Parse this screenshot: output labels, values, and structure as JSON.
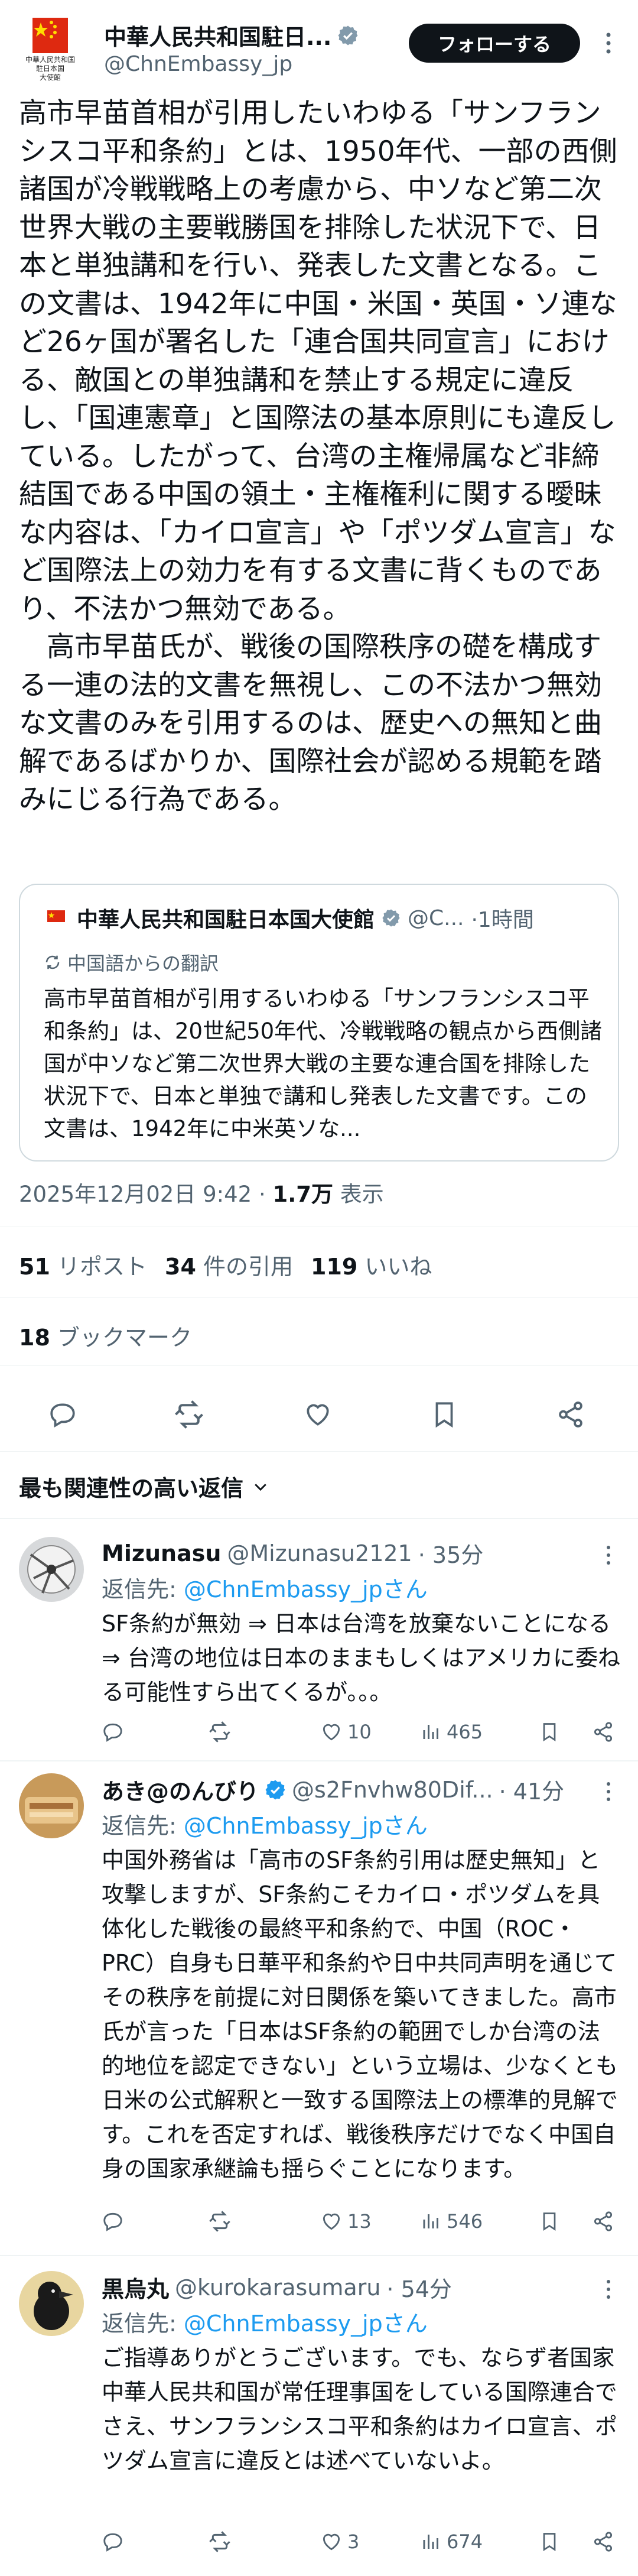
{
  "colors": {
    "accent": "#1d9bf0",
    "text": "#0f1419",
    "muted": "#536471",
    "verified": "#1d9bf0",
    "gold": "#e8b100"
  },
  "author": {
    "name": "中華人民共和国駐日...",
    "handle": "@ChnEmbassy_jp",
    "emblem_text": "中華人民共和国\n駐日本国\n大使館",
    "follow_label": "フォローする"
  },
  "tweet": {
    "text": "高市早苗首相が引用したいわゆる「サンフランシスコ平和条約」とは、1950年代、一部の西側諸国が冷戦戦略上の考慮から、中ソなど第二次世界大戦の主要戦勝国を排除した状況下で、日本と単独講和を行い、発表した文書となる。この文書は、1942年に中国・米国・英国・ソ連など26ヶ国が署名した「連合国共同宣言」における、敵国との単独講和を禁止する規定に違反し、「国連憲章」と国際法の基本原則にも違反している。したがって、台湾の主権帰属など非締結国である中国の領土・主権権利に関する曖昧な内容は、「カイロ宣言」や「ポツダム宣言」など国際法上の効力を有する文書に背くものであり、不法かつ無効である。\n　高市早苗氏が、戦後の国際秩序の礎を構成する一連の法的文書を無視し、この不法かつ無効な文書のみを引用するのは、歴史への無知と曲解であるばかりか、国際社会が認める規範を踏みにじる行為である。"
  },
  "quote": {
    "name": "中華人民共和国駐日本国大使館",
    "handle": "@C...",
    "time": "·1時間",
    "translated_label": "中国語からの翻訳",
    "text": "高市早苗首相が引用するいわゆる「サンフランシスコ平和条約」は、20世紀50年代、冷戦戦略の観点から西側諸国が中ソなど第二次世界大戦の主要な連合国を排除した状況下で、日本と単独で講和し発表した文書です。この文書は、1942年に中米英ソな..."
  },
  "meta": {
    "datetime": "2025年12月02日 9:42",
    "views_count": "1.7万",
    "views_label": "表示"
  },
  "stats": {
    "reposts_count": "51",
    "reposts_label": "リポスト",
    "quotes_count": "34",
    "quotes_label": "件の引用",
    "likes_count": "119",
    "likes_label": "いいね",
    "bookmarks_count": "18",
    "bookmarks_label": "ブックマーク"
  },
  "sort": {
    "label": "最も関連性の高い返信"
  },
  "replies": [
    {
      "name": "Mizunasu",
      "handle": "@Mizunasu2121",
      "time": "· 35分",
      "verified": false,
      "reply_to_prefix": "返信先: ",
      "reply_to": "@ChnEmbassy_jpさん",
      "text": "SF条約が無効 ⇒ 日本は台湾を放棄ないことになる⇒ 台湾の地位は日本のままもしくはアメリカに委ねる可能性すら出てくるが。。。",
      "likes": "10",
      "views": "465"
    },
    {
      "name": "あき@のんびり",
      "handle": "@s2Fnvhw80Dif...",
      "time": "· 41分",
      "verified": true,
      "reply_to_prefix": "返信先: ",
      "reply_to": "@ChnEmbassy_jpさん",
      "text": "中国外務省は「高市のSF条約引用は歴史無知」と攻撃しますが、SF条約こそカイロ・ポツダムを具体化した戦後の最終平和条約で、中国（ROC・PRC）自身も日華平和条約や日中共同声明を通じてその秩序を前提に対日関係を築いてきました。高市氏が言った「日本はSF条約の範囲でしか台湾の法的地位を認定できない」という立場は、少なくとも日米の公式解釈と一致する国際法上の標準的見解です。これを否定すれば、戦後秩序だけでなく中国自身の国家承継論も揺らぐことになります。",
      "likes": "13",
      "views": "546"
    },
    {
      "name": "黒烏丸",
      "handle": "@kurokarasumaru",
      "time": "· 54分",
      "verified": false,
      "reply_to_prefix": "返信先: ",
      "reply_to": "@ChnEmbassy_jpさん",
      "text": "ご指導ありがとうございます。でも、ならず者国家中華人民共和国が常任理事国をしている国際連合でさえ、サンフランシスコ平和条約はカイロ宣言、ポツダム宣言に違反とは述べていないよ。",
      "likes": "3",
      "views": "674"
    }
  ]
}
